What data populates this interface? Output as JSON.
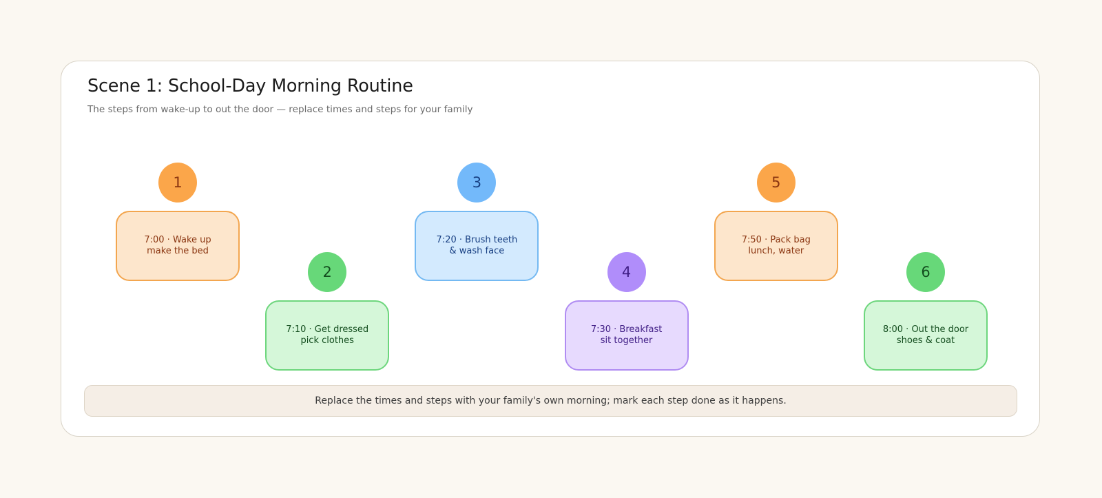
{
  "title": "Scene 1: School-Day Morning Routine",
  "subtitle": "The steps from wake-up to out the door — replace times and steps for your family",
  "steps": [
    {
      "number": "1",
      "line1": "7:00 · Wake up",
      "line2": "make the bed",
      "row": "top",
      "fill": "#fde6cc",
      "stroke": "#f3a64f",
      "badge": "#fba64a",
      "badge_text": "#8a3510",
      "text": "#8a3510"
    },
    {
      "number": "2",
      "line1": "7:10 · Get dressed",
      "line2": "pick clothes",
      "row": "bottom",
      "fill": "#d5f7d9",
      "stroke": "#6dd67d",
      "badge": "#67d879",
      "badge_text": "#134d1e",
      "text": "#134d1e"
    },
    {
      "number": "3",
      "line1": "7:20 · Brush teeth",
      "line2": "& wash face",
      "row": "top",
      "fill": "#d3eafe",
      "stroke": "#74b9f2",
      "badge": "#73b9fa",
      "badge_text": "#173f82",
      "text": "#173f82"
    },
    {
      "number": "4",
      "line1": "7:30 · Breakfast",
      "line2": "sit together",
      "row": "bottom",
      "fill": "#e7dafe",
      "stroke": "#b08cf2",
      "badge": "#b08dfa",
      "badge_text": "#3f1d85",
      "text": "#3f1d85"
    },
    {
      "number": "5",
      "line1": "7:50 · Pack bag",
      "line2": "lunch, water",
      "row": "top",
      "fill": "#fde6cc",
      "stroke": "#f3a64f",
      "badge": "#fba64a",
      "badge_text": "#8a3510",
      "text": "#8a3510"
    },
    {
      "number": "6",
      "line1": "8:00 · Out the door",
      "line2": "shoes & coat",
      "row": "bottom",
      "fill": "#d5f7d9",
      "stroke": "#6dd67d",
      "badge": "#67d879",
      "badge_text": "#134d1e",
      "text": "#134d1e"
    }
  ],
  "footer_note": "Replace the times and steps with your family's own morning; mark each step done as it happens."
}
